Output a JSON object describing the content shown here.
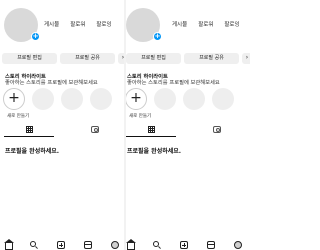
{
  "screens": [
    {
      "stats": [
        "게시물",
        "팔로워",
        "팔로잉"
      ],
      "buttons": [
        "프로필 편집",
        "프로필 공유"
      ],
      "add_person_icon": "add-person-icon",
      "story": {
        "title": "스토리 하이라이트",
        "subtitle": "좋아하는 스토리를 프로필에 보관해보세요"
      },
      "highlight_new_label": "새로 만들기",
      "tabs": [
        "grid-icon",
        "tagged-icon"
      ],
      "empty_title": "프로필을 완성하세요.",
      "nav": [
        "home-icon",
        "search-icon",
        "create-icon",
        "reels-icon",
        "profile-icon"
      ]
    },
    {
      "stats": [
        "게시물",
        "팔로워",
        "팔로잉"
      ],
      "buttons": [
        "프로필 편집",
        "프로필 공유"
      ],
      "add_person_icon": "add-person-icon",
      "story": {
        "title": "스토리 하이라이트",
        "subtitle": "좋아하는 스토리를 프로필에 보관해보세요"
      },
      "highlight_new_label": "새로 만들기",
      "tabs": [
        "grid-icon",
        "tagged-icon"
      ],
      "empty_title": "프로필을 완성하세요.",
      "nav": [
        "home-icon",
        "search-icon",
        "create-icon",
        "reels-icon",
        "profile-icon"
      ]
    }
  ],
  "colors": {
    "accent": "#0095f6",
    "button_bg": "#efefef",
    "avatar_bg": "#d9d9d9"
  }
}
